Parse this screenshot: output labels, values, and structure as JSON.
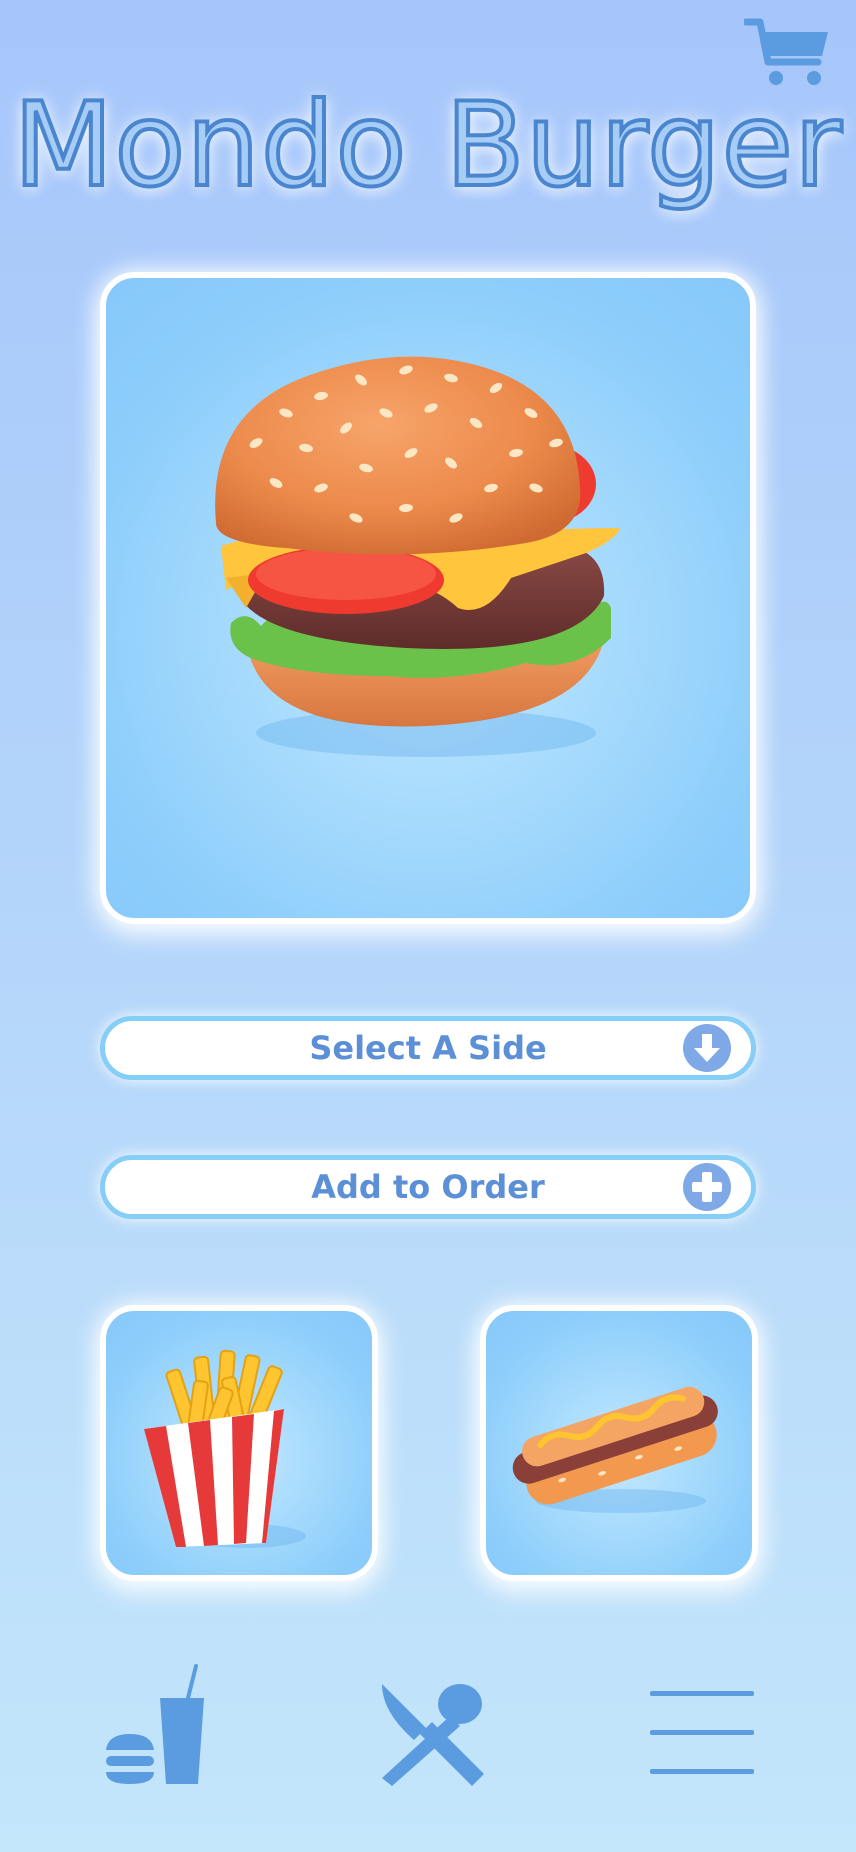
{
  "header": {
    "title": "Mondo Burger",
    "cart_icon": "shopping-cart-icon"
  },
  "hero": {
    "item_icon": "burger-image"
  },
  "actions": {
    "select_side_label": "Select A Side",
    "select_side_icon": "arrow-down-circle-icon",
    "add_to_order_label": "Add to Order",
    "add_to_order_icon": "plus-circle-icon"
  },
  "sides": [
    {
      "icon": "fries-image"
    },
    {
      "icon": "hotdog-image"
    }
  ],
  "bottom_nav": {
    "items": [
      {
        "icon": "drinks-burger-icon"
      },
      {
        "icon": "fork-spoon-icon"
      },
      {
        "icon": "hamburger-menu-icon"
      }
    ]
  },
  "colors": {
    "accent": "#5b8fd6",
    "title_outline": "#4a86d0",
    "card_bg": "#8ccdfb",
    "pill_border": "#86cdf7",
    "icon_blue": "#5b9be0"
  }
}
